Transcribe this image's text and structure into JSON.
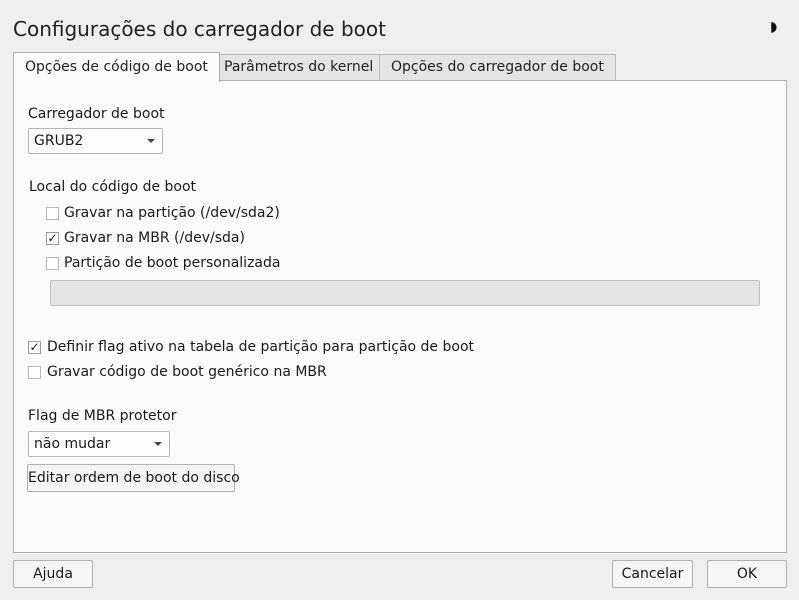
{
  "window": {
    "title": "Configurações do carregador de boot",
    "moon_icon": "◗"
  },
  "tabs": [
    {
      "label": "Opções de código de boot",
      "active": true
    },
    {
      "label": "Parâmetros do kernel",
      "active": false
    },
    {
      "label": "Opções do carregador de boot",
      "active": false
    }
  ],
  "bootloader": {
    "label": "Carregador de boot",
    "value": "GRUB2"
  },
  "location": {
    "label": "Local do código de boot",
    "options": [
      {
        "label": "Gravar na partição (/dev/sda2)",
        "checked": false
      },
      {
        "label": "Gravar na MBR (/dev/sda)",
        "checked": true
      },
      {
        "label": "Partição de boot personalizada",
        "checked": false
      }
    ],
    "custom_partition_value": ""
  },
  "flags": [
    {
      "label": "Definir flag ativo na tabela de partição para partição de boot",
      "checked": true
    },
    {
      "label": "Gravar código de boot genérico na MBR",
      "checked": false
    }
  ],
  "protective_mbr": {
    "label": "Flag de MBR protetor",
    "value": "não mudar"
  },
  "edit_order_button": "Editar ordem de boot do disco",
  "footer": {
    "help": "Ajuda",
    "cancel": "Cancelar",
    "ok": "OK"
  },
  "check_glyph": "✓"
}
